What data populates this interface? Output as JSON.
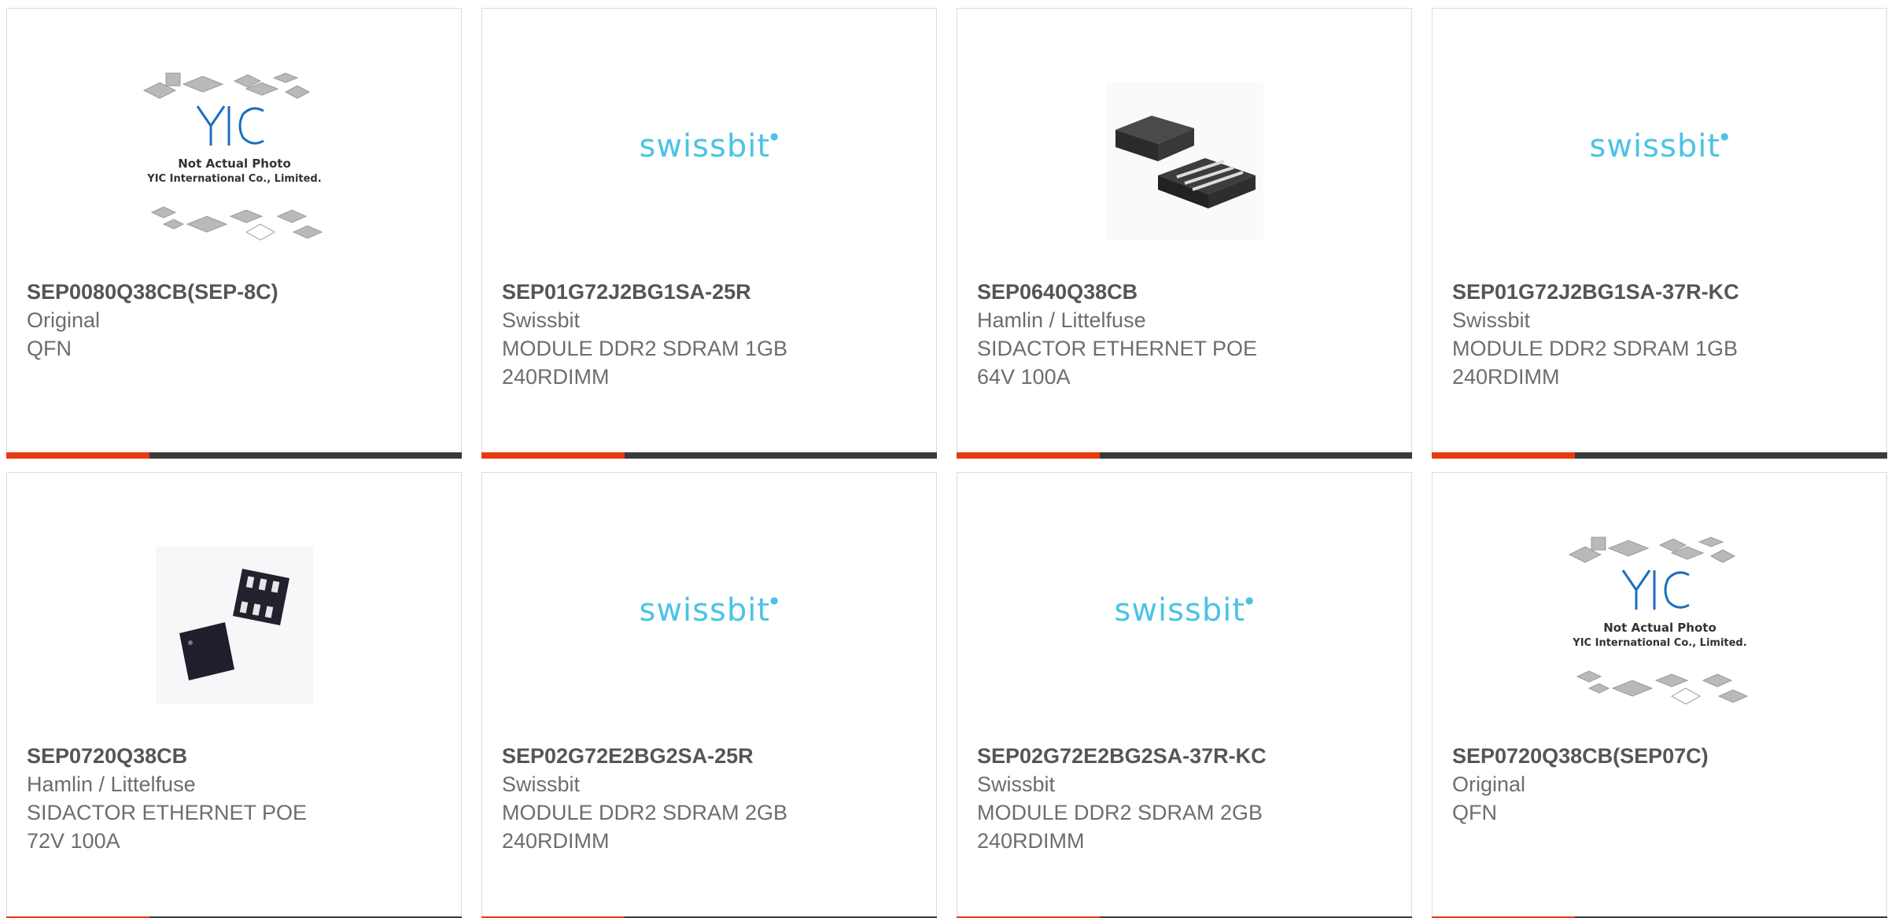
{
  "products": [
    {
      "part_number": "SEP0080Q38CB(SEP-8C)",
      "manufacturer": "Original",
      "description": "QFN",
      "image": "placeholder-photo-icon",
      "placeholder_brand": "YIC",
      "placeholder_line1": "Not Actual Photo",
      "placeholder_line2": "YIC International Co., Limited."
    },
    {
      "part_number": "SEP01G72J2BG1SA-25R",
      "manufacturer": "Swissbit",
      "description": "MODULE DDR2 SDRAM 1GB\n240RDIMM",
      "image": "swissbit-logo",
      "logo_text": "swissbit"
    },
    {
      "part_number": "SEP0640Q38CB",
      "manufacturer": "Hamlin / Littelfuse",
      "description": "SIDACTOR ETHERNET POE\n64V 100A",
      "image": "chip-package-photo"
    },
    {
      "part_number": "SEP01G72J2BG1SA-37R-KC",
      "manufacturer": "Swissbit",
      "description": "MODULE DDR2 SDRAM 1GB\n240RDIMM",
      "image": "swissbit-logo",
      "logo_text": "swissbit"
    },
    {
      "part_number": "SEP0720Q38CB",
      "manufacturer": "Hamlin / Littelfuse",
      "description": "SIDACTOR ETHERNET POE\n72V 100A",
      "image": "chip-pair-photo"
    },
    {
      "part_number": "SEP02G72E2BG2SA-25R",
      "manufacturer": "Swissbit",
      "description": "MODULE DDR2 SDRAM 2GB\n240RDIMM",
      "image": "swissbit-logo",
      "logo_text": "swissbit"
    },
    {
      "part_number": "SEP02G72E2BG2SA-37R-KC",
      "manufacturer": "Swissbit",
      "description": "MODULE DDR2 SDRAM 2GB\n240RDIMM",
      "image": "swissbit-logo",
      "logo_text": "swissbit"
    },
    {
      "part_number": "SEP0720Q38CB(SEP07C)",
      "manufacturer": "Original",
      "description": "QFN",
      "image": "placeholder-photo-icon",
      "placeholder_brand": "YIC",
      "placeholder_line1": "Not Actual Photo",
      "placeholder_line2": "YIC International Co., Limited."
    }
  ],
  "colors": {
    "accent": "#e83a10",
    "bar": "#3a3a3a",
    "swissbit": "#4cc3e4",
    "yic": "#1a6fc0"
  }
}
